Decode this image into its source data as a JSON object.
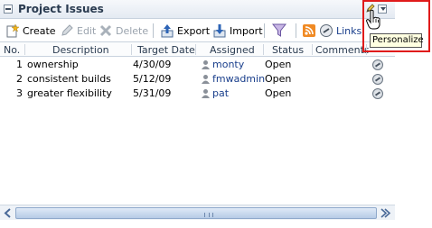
{
  "panel": {
    "title": "Project Issues"
  },
  "toolbar": {
    "create": "Create",
    "edit": "Edit",
    "delete": "Delete",
    "export": "Export",
    "import": "Import",
    "links": "Links"
  },
  "table": {
    "headers": [
      "No.",
      "Description",
      "Target Date",
      "Assigned",
      "Status",
      "Comments"
    ],
    "rows": [
      {
        "no": "1",
        "description": "ownership",
        "target_date": "4/30/09",
        "assigned": "monty",
        "status": "Open"
      },
      {
        "no": "2",
        "description": "consistent builds",
        "target_date": "5/12/09",
        "assigned": "fmwadmin",
        "status": "Open"
      },
      {
        "no": "3",
        "description": "greater flexibility",
        "target_date": "5/31/09",
        "assigned": "pat",
        "status": "Open"
      }
    ]
  },
  "tooltip": {
    "text": "Personalize"
  },
  "colors": {
    "highlight": "#e01b1b",
    "link": "#1a3f8c",
    "header_bg": "#e4eaf2"
  }
}
